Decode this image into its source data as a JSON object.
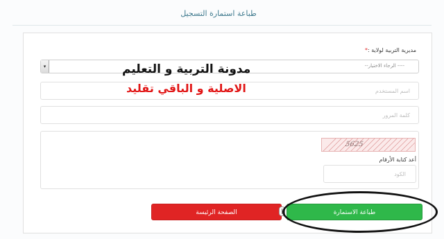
{
  "header": {
    "title": "طباعة استمارة التسجيل"
  },
  "form": {
    "directorate_label": "مديرية التربية لولاية :",
    "required_mark": "*",
    "directorate_select": {
      "value": "--الرجاء الاختيار ----"
    },
    "username_placeholder": "اسم المستخدم",
    "password_placeholder": "كلمة المرور",
    "captcha": {
      "text": "5625"
    },
    "code_label": "أعد كتابة الأرقام",
    "code_placeholder": "الكود"
  },
  "overlay": {
    "line1": "مدونة التربية و التعليم",
    "line2": "الاصلية و الباقي تقليد",
    "line2_color": "#e11515"
  },
  "buttons": {
    "home_label": "الصفحة الرئيسة",
    "print_label": "طباعة الاستمارة",
    "home_color": "#e02424",
    "print_color": "#2fb84a"
  }
}
